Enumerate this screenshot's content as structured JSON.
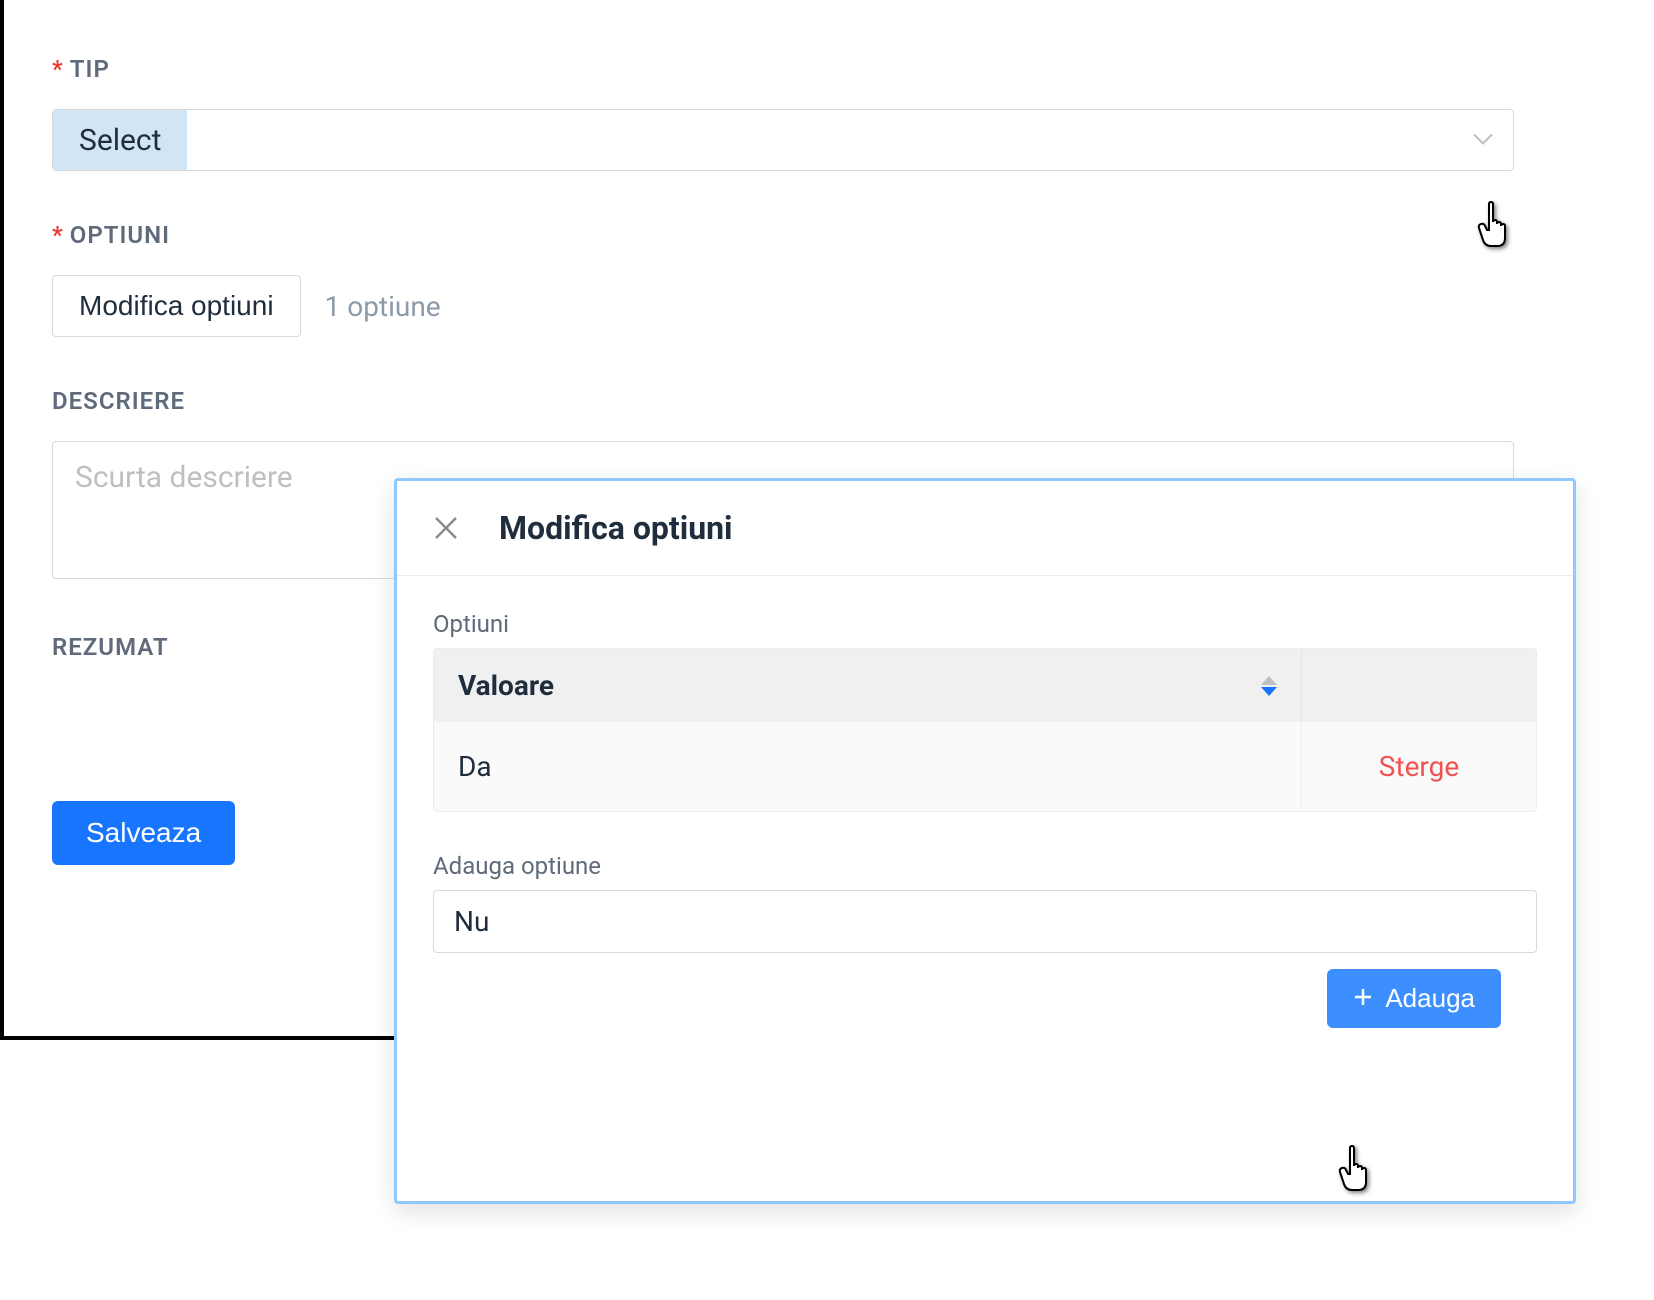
{
  "fields": {
    "tip": {
      "label": "TIP",
      "selected": "Select"
    },
    "optiuni": {
      "label": "OPTIUNI",
      "button": "Modifica optiuni",
      "count": "1 optiune"
    },
    "descriere": {
      "label": "DESCRIERE",
      "placeholder": "Scurta descriere"
    },
    "rezumat": {
      "label": "REZUMAT"
    }
  },
  "actions": {
    "save": "Salveaza"
  },
  "modal": {
    "title": "Modifica optiuni",
    "section_label": "Optiuni",
    "column_valoare": "Valoare",
    "row_value": "Da",
    "delete": "Sterge",
    "add_label": "Adauga optiune",
    "add_value": "Nu",
    "add_button": "Adauga"
  }
}
